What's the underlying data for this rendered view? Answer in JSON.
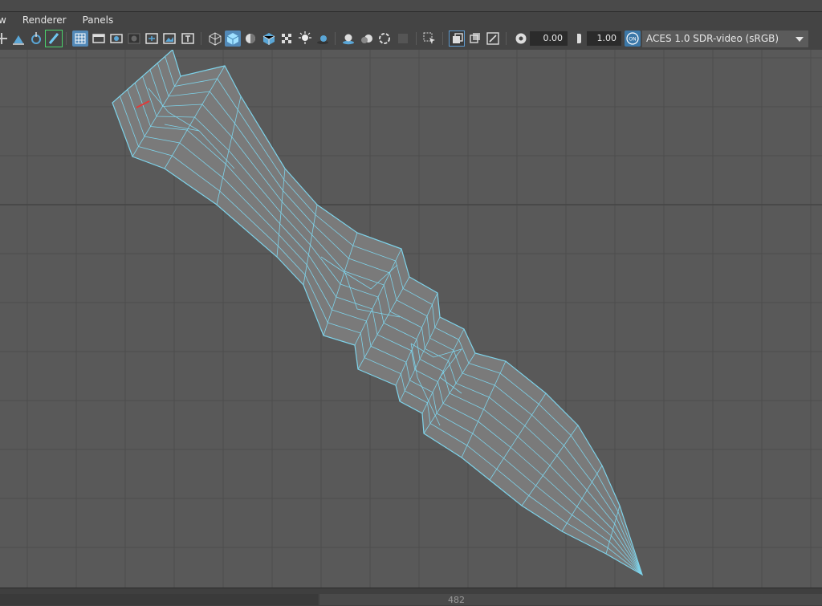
{
  "menubar": {
    "items": [
      {
        "label": "w"
      },
      {
        "label": "Renderer"
      },
      {
        "label": "Panels"
      }
    ]
  },
  "toolbar": {
    "icons": [
      "transform-icon",
      "snap-icon",
      "move-pivot-icon",
      "paint-brush-icon",
      "grid-icon",
      "film-gate-icon",
      "resolution-gate-icon",
      "gate-mask-icon",
      "field-chart-icon",
      "safe-action-icon",
      "safe-title-icon",
      "wireframe-icon",
      "smooth-shade-icon",
      "default-material-icon",
      "textured-icon",
      "checker-icon",
      "lights-icon",
      "shadows-icon",
      "ambient-occlusion-icon",
      "motion-blur-icon",
      "antialias-icon",
      "depth-of-field-icon",
      "select-camera-icon",
      "isolate-select-icon",
      "xray-icon",
      "xray-joints-icon",
      "exposure-icon",
      "gamma-icon",
      "color-management-icon"
    ],
    "exposure_value": "0.00",
    "gamma_value": "1.00",
    "color_management_label": "ON",
    "view_transform": "ACES 1.0 SDR-video (sRGB)"
  },
  "colors": {
    "accent": "#5289b8",
    "wire": "#7ed3ea",
    "mesh_fill": "#7a7a7a",
    "selected_edge": "#e03a3a"
  },
  "status": {
    "value": "482"
  }
}
